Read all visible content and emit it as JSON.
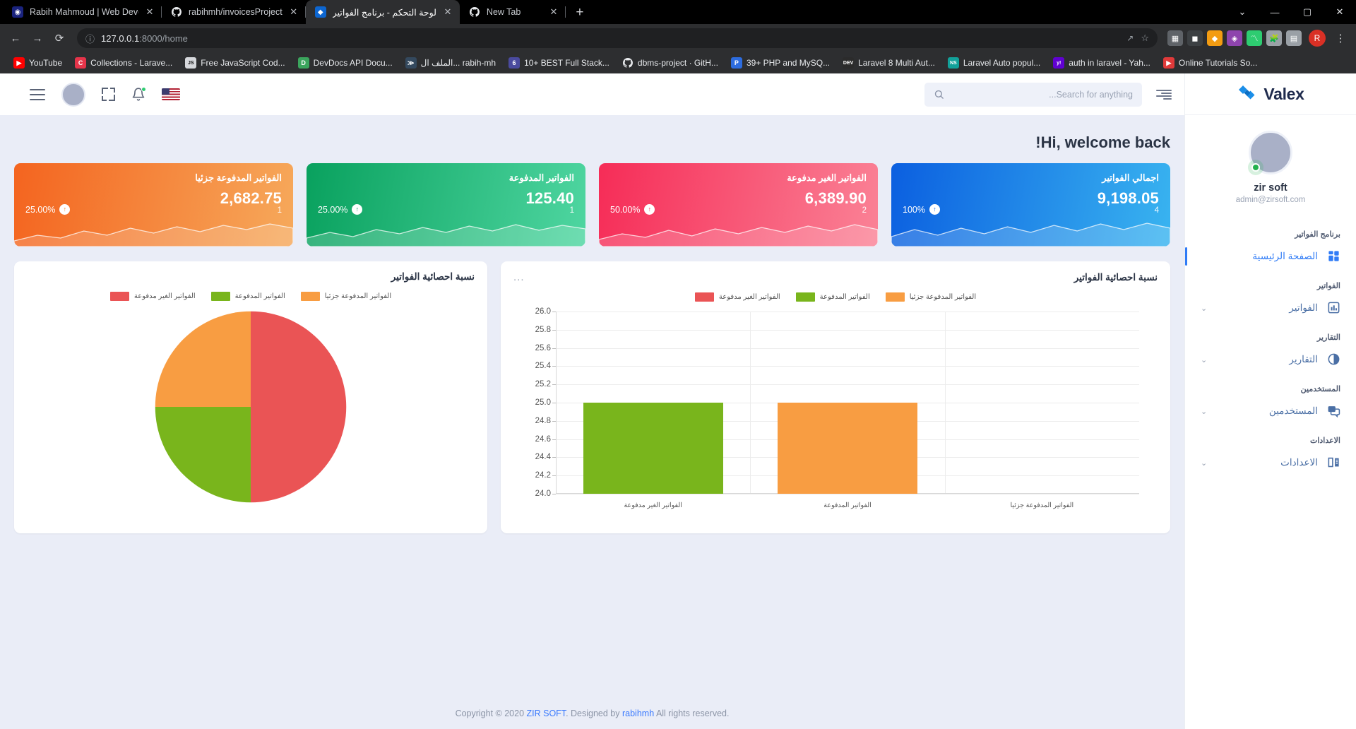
{
  "browser": {
    "tabs": [
      {
        "title": "Rabih Mahmoud | Web Develope",
        "favicon": "site-icon",
        "color": "#1a237e",
        "glyph": "◉",
        "rtl": false,
        "active": false
      },
      {
        "title": "rabihmh/invoicesProject",
        "favicon": "github-icon",
        "color": "#ffffff",
        "glyph": "",
        "rtl": false,
        "active": false
      },
      {
        "title": "لوحة التحكم - برنامج الفواتير",
        "favicon": "valex-icon",
        "color": "#0d66d0",
        "glyph": "◆",
        "rtl": true,
        "active": true
      },
      {
        "title": "New Tab",
        "favicon": "github-icon",
        "color": "#ffffff",
        "glyph": "",
        "rtl": false,
        "active": false
      }
    ],
    "new_tab_label": "+",
    "close_label": "✕",
    "window_controls": {
      "minimize": "—",
      "maximize": "▢",
      "close": "✕",
      "expand": "⌄"
    },
    "nav": {
      "back": "←",
      "forward": "→",
      "reload": "⟳",
      "info": "ⓘ",
      "star": "☆",
      "share": "↗"
    },
    "url": {
      "host": "127.0.0.1",
      "rest": ":8000/home"
    },
    "extensions": [
      {
        "name": "extension-grid",
        "glyph": "▦",
        "color": "#5f6368"
      },
      {
        "name": "extension-dark",
        "glyph": "◼",
        "color": "#3c4043"
      },
      {
        "name": "extension-orange",
        "glyph": "◆",
        "color": "#f39c12"
      },
      {
        "name": "extension-purple",
        "glyph": "◈",
        "color": "#8e44ad"
      },
      {
        "name": "extension-chart",
        "glyph": "〽",
        "color": "#2ecc71"
      },
      {
        "name": "extension-puzzle",
        "glyph": "🧩",
        "color": "#9aa0a6"
      },
      {
        "name": "extension-panel",
        "glyph": "▤",
        "color": "#9aa0a6"
      }
    ],
    "profile_initial": "R",
    "menu_glyph": "⋮",
    "bookmarks": [
      {
        "label": "YouTube",
        "icon_color": "#ff0000",
        "glyph": "▶",
        "rtl": false
      },
      {
        "label": "Collections - Larave...",
        "icon_color": "#e5344a",
        "glyph": "C",
        "rtl": false
      },
      {
        "label": "Free JavaScript Cod...",
        "icon_color": "#d6d8dc",
        "glyph": "JS",
        "rtl": false
      },
      {
        "label": "DevDocs API Docu...",
        "icon_color": "#3ba55d",
        "glyph": "D",
        "rtl": false
      },
      {
        "label": "rabih-mh ...الملف ال",
        "icon_color": "#34495e",
        "glyph": "≫",
        "rtl": true
      },
      {
        "label": "10+ BEST Full Stack...",
        "icon_color": "#4a4a9e",
        "glyph": "6",
        "rtl": false
      },
      {
        "label": "dbms-project · GitH...",
        "icon_color": "#ffffff",
        "glyph": "",
        "rtl": false
      },
      {
        "label": "39+ PHP and MySQ...",
        "icon_color": "#2d6cdf",
        "glyph": "P",
        "rtl": false
      },
      {
        "label": "Laravel 8 Multi Aut...",
        "icon_color": "#2b2b2b",
        "glyph": "DEV",
        "rtl": false
      },
      {
        "label": "Laravel Auto popul...",
        "icon_color": "#12a19a",
        "glyph": "NS",
        "rtl": false
      },
      {
        "label": "auth in laravel - Yah...",
        "icon_color": "#6001d2",
        "glyph": "y!",
        "rtl": false
      },
      {
        "label": "Online Tutorials So...",
        "icon_color": "#e03a3a",
        "glyph": "▶",
        "rtl": false
      }
    ]
  },
  "topbar": {
    "menu_icon": "hamburger-icon",
    "avatar": "user-avatar",
    "fullscreen_icon": "fullscreen-icon",
    "bell_icon": "notification-bell-icon",
    "flag": "us-flag-icon",
    "search": {
      "placeholder": "Search for anything...",
      "value": "",
      "icon": "search-icon"
    },
    "list_icon": "list-toggle-icon"
  },
  "main": {
    "welcome": "Hi, welcome back!",
    "cards": [
      {
        "title": "الفواتير المدفوعة جزئيا",
        "value": "2,682.75",
        "percent": "25.00%",
        "count": "1",
        "arrow": "↑",
        "color_from": "#f4641f",
        "color_to": "#f6a95b",
        "arrow_color": "#f4791f"
      },
      {
        "title": "الفواتير المدفوعة",
        "value": "125.40",
        "percent": "25.00%",
        "count": "1",
        "arrow": "↑",
        "color_from": "#09a15e",
        "color_to": "#4fd6a1",
        "arrow_color": "#09a15e"
      },
      {
        "title": "الفواتير الغير مدفوعة",
        "value": "6,389.90",
        "percent": "50.00%",
        "count": "2",
        "arrow": "↑",
        "color_from": "#f62c57",
        "color_to": "#fa8296",
        "arrow_color": "#f62c57"
      },
      {
        "title": "اجمالي الفواتير",
        "value": "9,198.05",
        "percent": "100%",
        "count": "4",
        "arrow": "↑",
        "color_from": "#0b5fe0",
        "color_to": "#39b4f0",
        "arrow_color": "#0b5fe0"
      }
    ],
    "pie_panel": {
      "title": "نسبة احصائية الفواتير"
    },
    "bar_panel": {
      "title": "نسبة احصائية الفواتير",
      "menu": "..."
    },
    "footer": {
      "prefix": "Copyright © 2020 ",
      "brand": "ZIR SOFT",
      "middle": ". Designed by ",
      "author": "rabihmh",
      "suffix": " All rights reserved."
    }
  },
  "sidebar": {
    "brand": "Valex",
    "user": {
      "name": "zir soft",
      "email": "admin@zirsoft.com",
      "status": "online"
    },
    "groups": [
      {
        "label": "برنامج الفواتير",
        "items": [
          {
            "label": "الصفحة الرئيسية",
            "icon": "dashboard-grid-icon",
            "active": true,
            "chevron": ""
          }
        ]
      },
      {
        "label": "الفواتير",
        "items": [
          {
            "label": "الفواتير",
            "icon": "bar-chart-icon",
            "active": false,
            "chevron": "⌄"
          }
        ]
      },
      {
        "label": "التقارير",
        "items": [
          {
            "label": "التقارير",
            "icon": "pie-chart-icon",
            "active": false,
            "chevron": "⌄"
          }
        ]
      },
      {
        "label": "المستخدمين",
        "items": [
          {
            "label": "المستخدمين",
            "icon": "chat-users-icon",
            "active": false,
            "chevron": "⌄"
          }
        ]
      },
      {
        "label": "الاعدادات",
        "items": [
          {
            "label": "الاعدادات",
            "icon": "book-settings-icon",
            "active": false,
            "chevron": "⌄"
          }
        ]
      }
    ]
  },
  "chart_data": [
    {
      "type": "pie",
      "title": "نسبة احصائية الفواتير",
      "labels": [
        "الفواتير المدفوعة جزئيا",
        "الفواتير المدفوعة",
        "الفواتير الغير مدفوعة"
      ],
      "values": [
        25,
        25,
        50
      ],
      "colors": [
        "#f89d42",
        "#79b51c",
        "#ea5455"
      ],
      "legend_position": "top",
      "legend": [
        {
          "label": "الفواتير المدفوعة جزئيا",
          "color": "#f89d42"
        },
        {
          "label": "الفواتير المدفوعة",
          "color": "#79b51c"
        },
        {
          "label": "الفواتير الغير مدفوعة",
          "color": "#ea5455"
        }
      ]
    },
    {
      "type": "bar",
      "title": "نسبة احصائية الفواتير",
      "categories": [
        "الفواتير الغير مدفوعة",
        "الفواتير المدفوعة",
        "الفواتير المدفوعة جزئيا"
      ],
      "values": [
        25,
        25,
        null
      ],
      "bar_colors": [
        "#79b51c",
        "#f89d42",
        "#ea5455"
      ],
      "ylim": [
        24.0,
        26.0
      ],
      "yticks": [
        "24.0",
        "24.2",
        "24.4",
        "24.6",
        "24.8",
        "25.0",
        "25.2",
        "25.4",
        "25.6",
        "25.8",
        "26.0"
      ],
      "xlabel": "",
      "ylabel": "",
      "grid": true,
      "legend_position": "top",
      "legend": [
        {
          "label": "الفواتير المدفوعة جزئيا",
          "color": "#f89d42"
        },
        {
          "label": "الفواتير المدفوعة",
          "color": "#79b51c"
        },
        {
          "label": "الفواتير الغير مدفوعة",
          "color": "#ea5455"
        }
      ]
    }
  ]
}
